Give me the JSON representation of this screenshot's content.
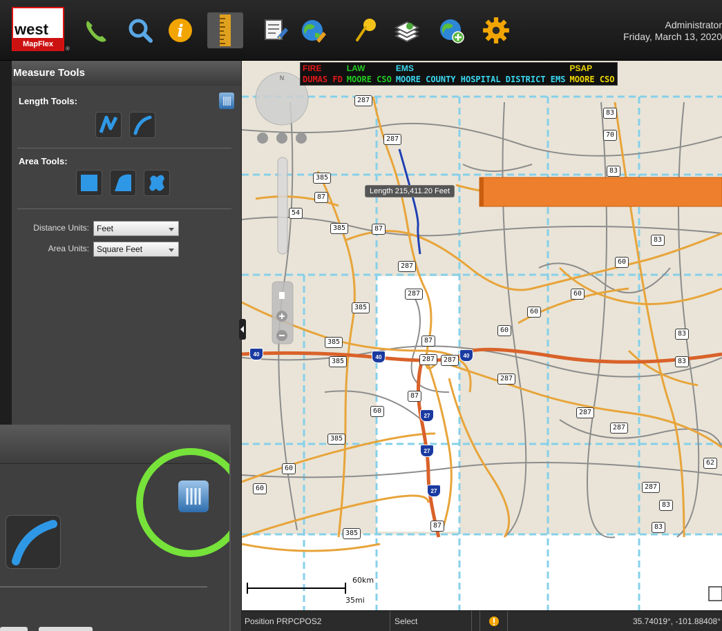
{
  "brand": {
    "logo_text": "west",
    "logo_sub": "MapFlex",
    "logo_mark": "®"
  },
  "toolbar": {
    "icons": [
      "phone-icon",
      "search-icon",
      "info-icon",
      "ruler-icon",
      "edit-document-icon",
      "globe-edit-icon",
      "pushpin-icon",
      "layers-icon",
      "globe-add-icon",
      "gear-icon"
    ],
    "active_tool": "ruler-icon"
  },
  "user": {
    "name": "Administrator",
    "date": "Friday, March 13, 2020"
  },
  "measure_tools": {
    "title": "Measure Tools",
    "length_title": "Length Tools:",
    "area_title": "Area Tools:",
    "distance_label": "Distance Units:",
    "distance_value": "Feet",
    "area_label": "Area Units:",
    "area_value": "Square Feet"
  },
  "agencies": {
    "headers": [
      "FIRE",
      "LAW",
      "EMS",
      "PSAP"
    ],
    "values": [
      "DUMAS FD",
      "MOORE CSO",
      "MOORE COUNTY HOSPITAL DISTRICT EMS",
      "MOORE CSO"
    ]
  },
  "map": {
    "measurement": "Length 215,411.20 Feet",
    "scale_km": "60km",
    "scale_mi": "35mi",
    "compass_n": "N",
    "route_labels": [
      {
        "text": "287"
      },
      {
        "text": "287"
      },
      {
        "text": "83"
      },
      {
        "text": "70"
      },
      {
        "text": "83"
      },
      {
        "text": "385"
      },
      {
        "text": "87"
      },
      {
        "text": "54"
      },
      {
        "text": "385"
      },
      {
        "text": "87"
      },
      {
        "text": "83"
      },
      {
        "text": "60"
      },
      {
        "text": "287"
      },
      {
        "text": "287"
      },
      {
        "text": "60"
      },
      {
        "text": "385"
      },
      {
        "text": "60"
      },
      {
        "text": "60"
      },
      {
        "text": "385"
      },
      {
        "text": "87"
      },
      {
        "text": "83"
      },
      {
        "text": "385"
      },
      {
        "text": "287"
      },
      {
        "text": "287"
      },
      {
        "text": "83"
      },
      {
        "text": "287"
      },
      {
        "text": "87"
      },
      {
        "text": "60"
      },
      {
        "text": "287"
      },
      {
        "text": "385"
      },
      {
        "text": "287"
      },
      {
        "text": "60"
      },
      {
        "text": "62"
      },
      {
        "text": "60"
      },
      {
        "text": "287"
      },
      {
        "text": "83"
      },
      {
        "text": "87"
      },
      {
        "text": "385"
      },
      {
        "text": "83"
      }
    ],
    "interstates": [
      {
        "text": "40"
      },
      {
        "text": "40"
      },
      {
        "text": "40"
      },
      {
        "text": "27"
      },
      {
        "text": "27"
      },
      {
        "text": "27"
      }
    ]
  },
  "status": {
    "position": "Position PRPCPOS2",
    "mode": "Select",
    "coords": "35.74019°, -101.88408°"
  },
  "colors": {
    "fire": "#e01818",
    "law": "#22cc22",
    "ems": "#3ad7f0",
    "psap": "#f0d800",
    "highlight_ring": "#76e23a"
  }
}
